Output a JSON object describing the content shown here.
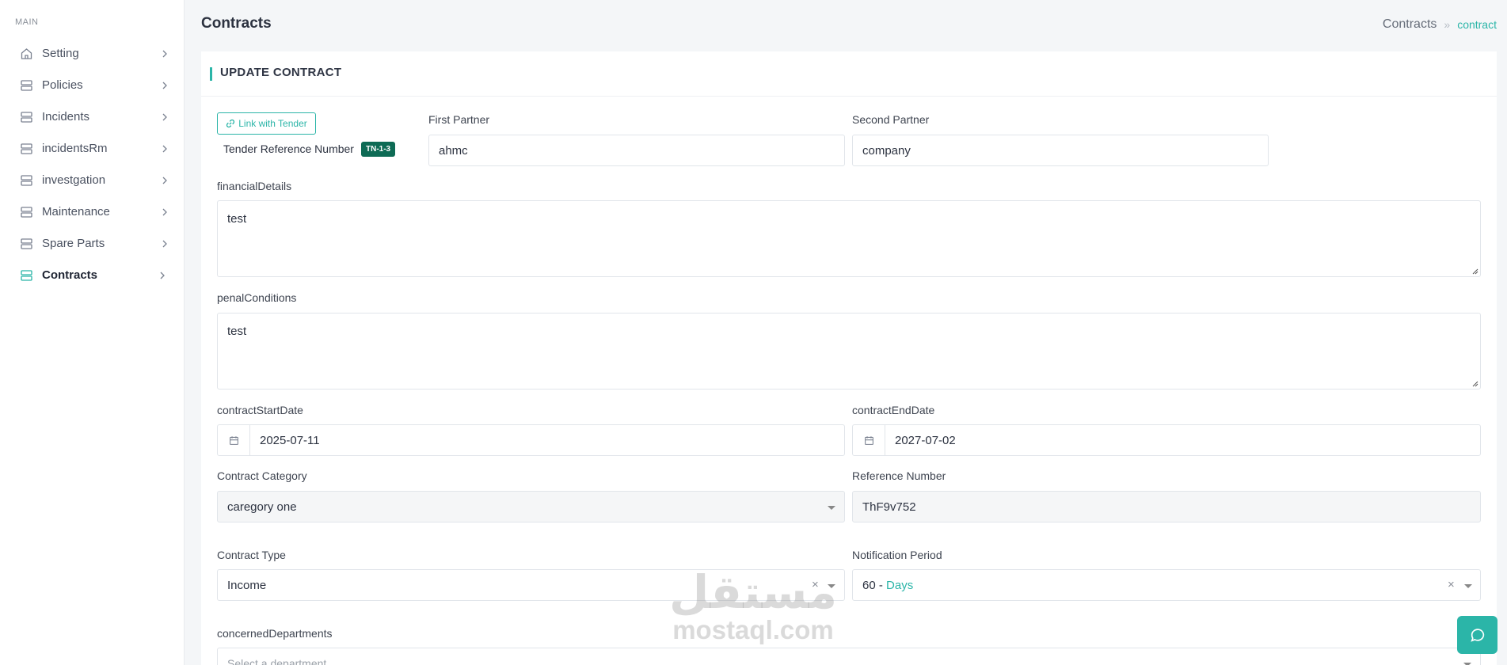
{
  "sidebar": {
    "section_label": "MAIN",
    "items": [
      {
        "label": "Setting",
        "icon": "home-icon"
      },
      {
        "label": "Policies",
        "icon": "server-icon"
      },
      {
        "label": "Incidents",
        "icon": "server-icon"
      },
      {
        "label": "incidentsRm",
        "icon": "server-icon"
      },
      {
        "label": "investgation",
        "icon": "server-icon"
      },
      {
        "label": "Maintenance",
        "icon": "server-icon"
      },
      {
        "label": "Spare Parts",
        "icon": "server-icon"
      },
      {
        "label": "Contracts",
        "icon": "server-icon",
        "active": true
      }
    ]
  },
  "header": {
    "title": "Contracts",
    "breadcrumb": {
      "parent": "Contracts",
      "separator": "»",
      "current": "contract"
    }
  },
  "card": {
    "title": "UPDATE CONTRACT"
  },
  "form": {
    "link_tender_label": "Link with Tender",
    "tender_reference_label": "Tender Reference Number",
    "tender_reference_value": "TN-1-3",
    "first_partner": {
      "label": "First Partner",
      "value": "ahmc"
    },
    "second_partner": {
      "label": "Second Partner",
      "value": "company"
    },
    "financial_details": {
      "label": "financialDetails",
      "value": "test"
    },
    "penal_conditions": {
      "label": "penalConditions",
      "value": "test"
    },
    "contract_start_date": {
      "label": "contractStartDate",
      "value": "2025-07-11"
    },
    "contract_end_date": {
      "label": "contractEndDate",
      "value": "2027-07-02"
    },
    "contract_category": {
      "label": "Contract Category",
      "value": "caregory one"
    },
    "reference_number": {
      "label": "Reference Number",
      "value": "ThF9v752"
    },
    "contract_type": {
      "label": "Contract Type",
      "value": "Income",
      "clear": "×"
    },
    "notification_period": {
      "label": "Notification Period",
      "value": "60 - ",
      "unit": "Days",
      "clear": "×"
    },
    "concerned_departments": {
      "label": "concernedDepartments",
      "placeholder": "Select a department"
    }
  },
  "watermark": {
    "arabic": "مستقل",
    "latin": "mostaql.com"
  },
  "colors": {
    "accent": "#2bb5a8",
    "badge": "#0e6b55"
  }
}
